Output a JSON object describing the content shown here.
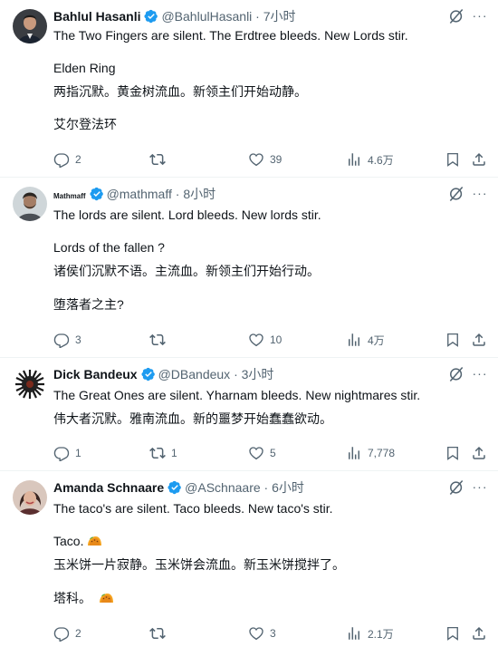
{
  "tweets": [
    {
      "name": "Bahlul Hasanli",
      "handle": "@BahlulHasanli",
      "time": "7小时",
      "lines": [
        "The Two Fingers are silent. The Erdtree bleeds. New Lords stir.",
        "Elden Ring",
        "两指沉默。黄金树流血。新领主们开始动静。",
        "艾尔登法环"
      ],
      "replies": "2",
      "retweets": "",
      "likes": "39",
      "views": "4.6万"
    },
    {
      "name": "Mathmaff",
      "handle": "@mathmaff",
      "time": "8小时",
      "lines": [
        "The lords are silent. Lord bleeds. New lords stir.",
        "Lords of the fallen ?",
        "诸侯们沉默不语。主流血。新领主们开始行动。",
        "堕落者之主?"
      ],
      "replies": "3",
      "retweets": "",
      "likes": "10",
      "views": "4万"
    },
    {
      "name": "Dick Bandeux",
      "handle": "@DBandeux",
      "time": "3小时",
      "lines": [
        "The Great Ones are silent. Yharnam bleeds. New nightmares stir.",
        "伟大者沉默。雅南流血。新的噩梦开始蠢蠢欲动。"
      ],
      "replies": "1",
      "retweets": "1",
      "likes": "5",
      "views": "7,778"
    },
    {
      "name": "Amanda Schnaare",
      "handle": "@ASchnaare",
      "time": "6小时",
      "lines": [
        "The taco's are silent. Taco bleeds. New taco's stir.",
        "Taco.",
        "玉米饼一片寂静。玉米饼会流血。新玉米饼搅拌了。",
        "塔科。"
      ],
      "replies": "2",
      "retweets": "",
      "likes": "3",
      "views": "2.1万"
    }
  ],
  "sep": " · ",
  "icons": {
    "reply": "reply-icon",
    "retweet": "retweet-icon",
    "like": "like-icon",
    "views": "views-icon",
    "bookmark": "bookmark-icon",
    "share": "share-icon",
    "grok": "grok-icon",
    "more": "more-icon",
    "verified": "verified-badge-icon",
    "taco": "taco-emoji"
  },
  "colors": {
    "verified": "#1d9bf0",
    "text": "#0f1419",
    "muted": "#536471"
  }
}
